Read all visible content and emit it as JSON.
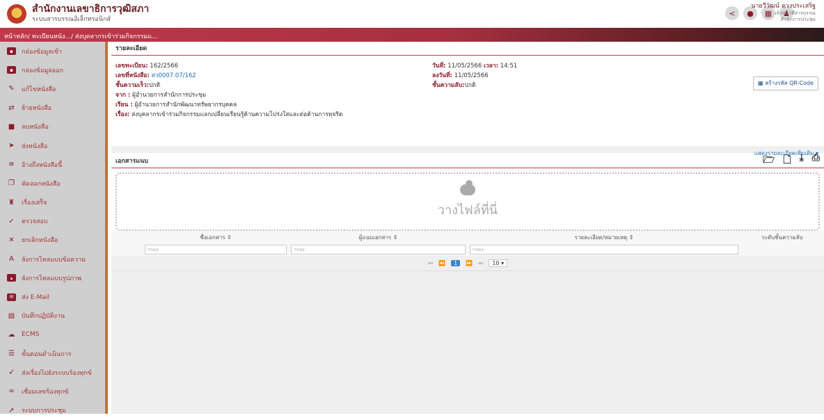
{
  "header": {
    "title": "สำนักงานเลขาธิการวุฒิสภา",
    "subtitle": "ระบบสารบรรณอิเล็กทรอนิกส์",
    "icons": [
      "share-icon",
      "bell-icon",
      "apps-grid-icon",
      "user-icon"
    ],
    "user_name": "นายวีวัฒน์ ดวงประเสริฐ",
    "user_role": "เจ้าหน้าที่สารบรรณ",
    "user_dept": "สำนักการประชุม"
  },
  "breadcrumb": "หน้าหลัก/ ทะเบียนหนัง.../ ส่งบุคลากรเข้าร่วมกิจกรรมแ...",
  "sidebar": {
    "items": [
      {
        "label": "กล่องข้อมูลเข้า",
        "icon": "inbox-icon"
      },
      {
        "label": "กล่องข้อมูลออก",
        "icon": "outbox-icon"
      },
      {
        "label": "แก้ไขหนังสือ",
        "icon": "pencil-icon"
      },
      {
        "label": "ย้ายหนังสือ",
        "icon": "move-arrows-icon"
      },
      {
        "label": "ลบหนังสือ",
        "icon": "trash-icon"
      },
      {
        "label": "ส่งหนังสือ",
        "icon": "send-icon"
      },
      {
        "label": "อ้างถึงหนังสือนี้",
        "icon": "reference-icon"
      },
      {
        "label": "คัดลอกหนังสือ",
        "icon": "copy-icon"
      },
      {
        "label": "เรื่องเสร็จ",
        "icon": "done-stamp-icon"
      },
      {
        "label": "ตรวจสอบ",
        "icon": "check-icon"
      },
      {
        "label": "ยกเลิกหนังสือ",
        "icon": "cancel-icon"
      },
      {
        "label": "ลังการไหลแบบข้อความ",
        "icon": "text-flow-icon"
      },
      {
        "label": "ลังการไหลแบบรูปภาพ",
        "icon": "image-flow-icon"
      },
      {
        "label": "ส่ง E-Mail",
        "icon": "mail-icon"
      },
      {
        "label": "บันทึกปฏิบัติงาน",
        "icon": "log-icon"
      },
      {
        "label": "ECMS",
        "icon": "cloud-icon"
      },
      {
        "label": "ขั้นตอนดำเนินการ",
        "icon": "steps-icon"
      },
      {
        "label": "ส่งเรื่องไปยังระบบร้องทุกข์",
        "icon": "forward-icon"
      },
      {
        "label": "เชื่อมเลขร้องทุกข์",
        "icon": "link-icon"
      },
      {
        "label": "ระบบการประชุม",
        "icon": "meeting-icon"
      }
    ]
  },
  "details": {
    "section_title": "รายละเอียด",
    "reg_no_label": "เลขทะเบียน:",
    "reg_no": "162/2566",
    "doc_no_label": "เลขที่หนังสือ:",
    "doc_no": "สว0007.07/162",
    "urgency_label": "ชั้นความเร็ว:",
    "urgency": "ปกติ",
    "from_label": "จาก :",
    "from": "ผู้อำนวยการสำนักการประชุม",
    "to_label": "เรียน :",
    "to": "ผู้อำนวยการสำนักพัฒนาทรัพยากรบุคคล",
    "subject_label": "เรื่อง:",
    "subject": "ส่งบุคลากรเข้าร่วมกิจกรรมแลกเปลี่ยนเรียนรู้ด้านความโปร่งใสและต่อต้านการทุจริต",
    "date_label": "วันที่:",
    "date": "11/05/2566",
    "time_label": "เวลา:",
    "time": "14:51",
    "sign_date_label": "ลงวันที่:",
    "sign_date": "11/05/2566",
    "secrecy_label": "ชั้นความลับ:",
    "secrecy": "ปกติ",
    "qr_button": "สร้างรหัส QR-Code",
    "more_link": "แสดงรายละเอียดเพิ่มเติม ▾"
  },
  "attachments": {
    "section_title": "เอกสารแนบ",
    "toolbar_icons": [
      "folder-open-icon",
      "new-file-icon",
      "download-icon",
      "print-icon"
    ],
    "drop_text": "วางไฟล์ที่นี่",
    "columns": [
      "ชื่อเอกสาร ⇕",
      "ผู้แนบเอกสาร ⇕",
      "รายละเอียด/หมายเหตุ ⇕",
      "ระดับชั้นความลับ"
    ],
    "filter_placeholder": "กรอง",
    "pager": {
      "first": "⏮",
      "prev": "⏪",
      "current": "1",
      "next": "⏩",
      "last": "⏭",
      "page_size": "10"
    }
  }
}
